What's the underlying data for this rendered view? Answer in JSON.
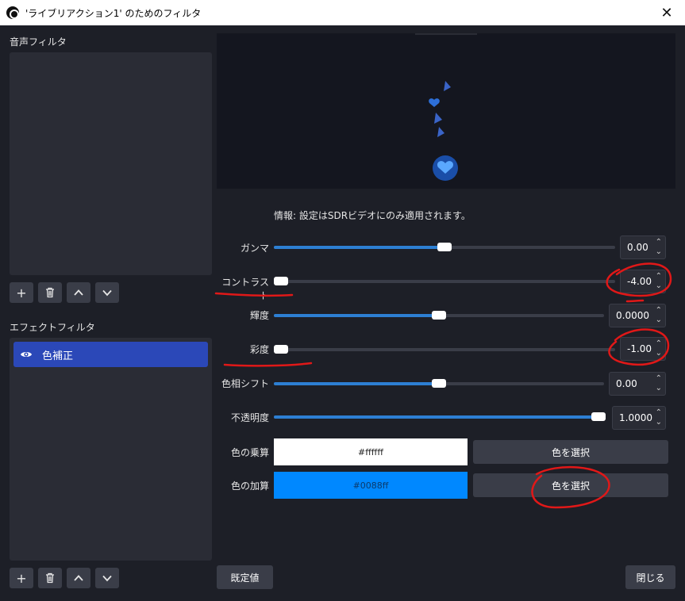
{
  "window": {
    "title": "'ライブリアクション1' のためのフィルタ",
    "close_glyph": "✕"
  },
  "audio_filters": {
    "label": "音声フィルタ",
    "items": []
  },
  "effect_filters": {
    "label": "エフェクトフィルタ",
    "items": [
      {
        "label": "色補正",
        "visible": true,
        "selected": true
      }
    ]
  },
  "toolbar": {
    "add": "+",
    "up": "⌃",
    "down": "⌄"
  },
  "info_text": "情報: 設定はSDRビデオにのみ適用されます。",
  "settings": {
    "gamma": {
      "label": "ガンマ",
      "value": "0.00",
      "level": 0.5
    },
    "contrast": {
      "label": "コントラスト",
      "value": "-4.00",
      "level": 0.0
    },
    "brightness": {
      "label": "輝度",
      "value": "0.0000",
      "level": 0.5
    },
    "saturation": {
      "label": "彩度",
      "value": "-1.00",
      "level": 0.0
    },
    "hue_shift": {
      "label": "色相シフト",
      "value": "0.00",
      "level": 0.5
    },
    "opacity": {
      "label": "不透明度",
      "value": "1.0000",
      "level": 1.0
    }
  },
  "color_multiply": {
    "label": "色の乗算",
    "value": "#ffffff",
    "button": "色を選択",
    "color": "#ffffff"
  },
  "color_add": {
    "label": "色の加算",
    "value": "#0088ff",
    "button": "色を選択",
    "color": "#0088ff"
  },
  "buttons": {
    "defaults": "既定値",
    "close": "閉じる"
  },
  "colors": {
    "accent": "#2d7fd3",
    "selected_item": "#2b48b8",
    "annotation": "#e01818"
  }
}
